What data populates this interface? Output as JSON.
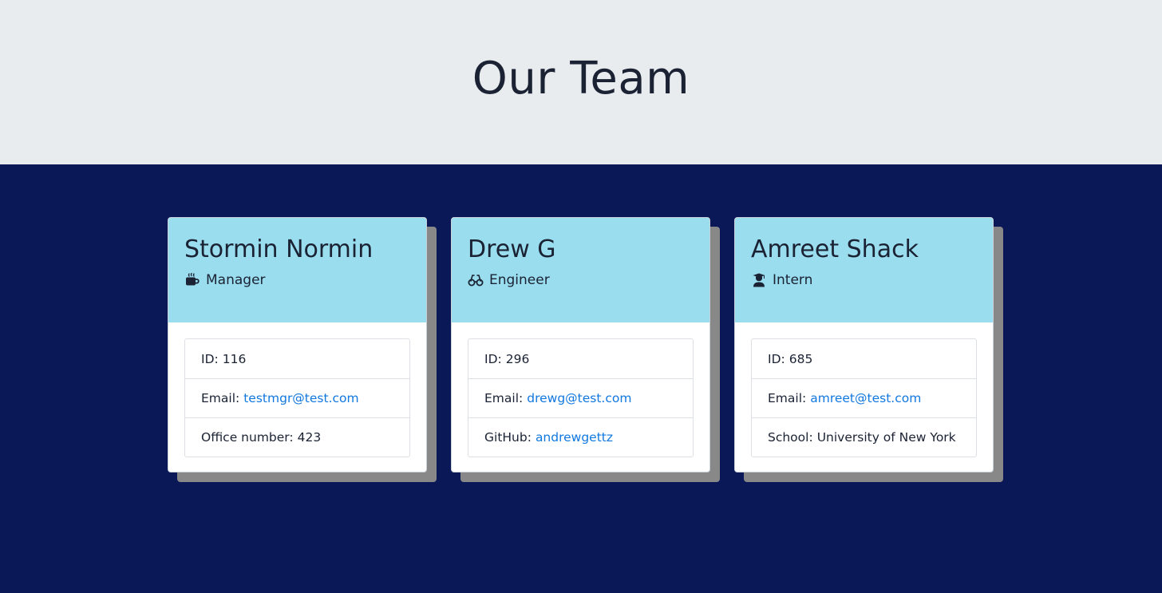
{
  "header": {
    "title": "Our Team"
  },
  "colors": {
    "header_bg": "#e8ecef",
    "page_bg": "#0a1857",
    "card_header_bg": "#99ddee",
    "link": "#1178e0"
  },
  "members": [
    {
      "name": "Stormin Normin",
      "role": "Manager",
      "icon": "coffee-mug-icon",
      "id_label": "ID:",
      "id": "116",
      "email_label": "Email:",
      "email": "testmgr@test.com",
      "extra_label": "Office number:",
      "extra_value": "423"
    },
    {
      "name": "Drew G",
      "role": "Engineer",
      "icon": "glasses-icon",
      "id_label": "ID:",
      "id": "296",
      "email_label": "Email:",
      "email": "drewg@test.com",
      "extra_label": "GitHub:",
      "extra_value": "andrewgettz"
    },
    {
      "name": "Amreet Shack",
      "role": "Intern",
      "icon": "graduate-icon",
      "id_label": "ID:",
      "id": "685",
      "email_label": "Email:",
      "email": "amreet@test.com",
      "extra_label": "School:",
      "extra_value": "University of New York"
    }
  ]
}
